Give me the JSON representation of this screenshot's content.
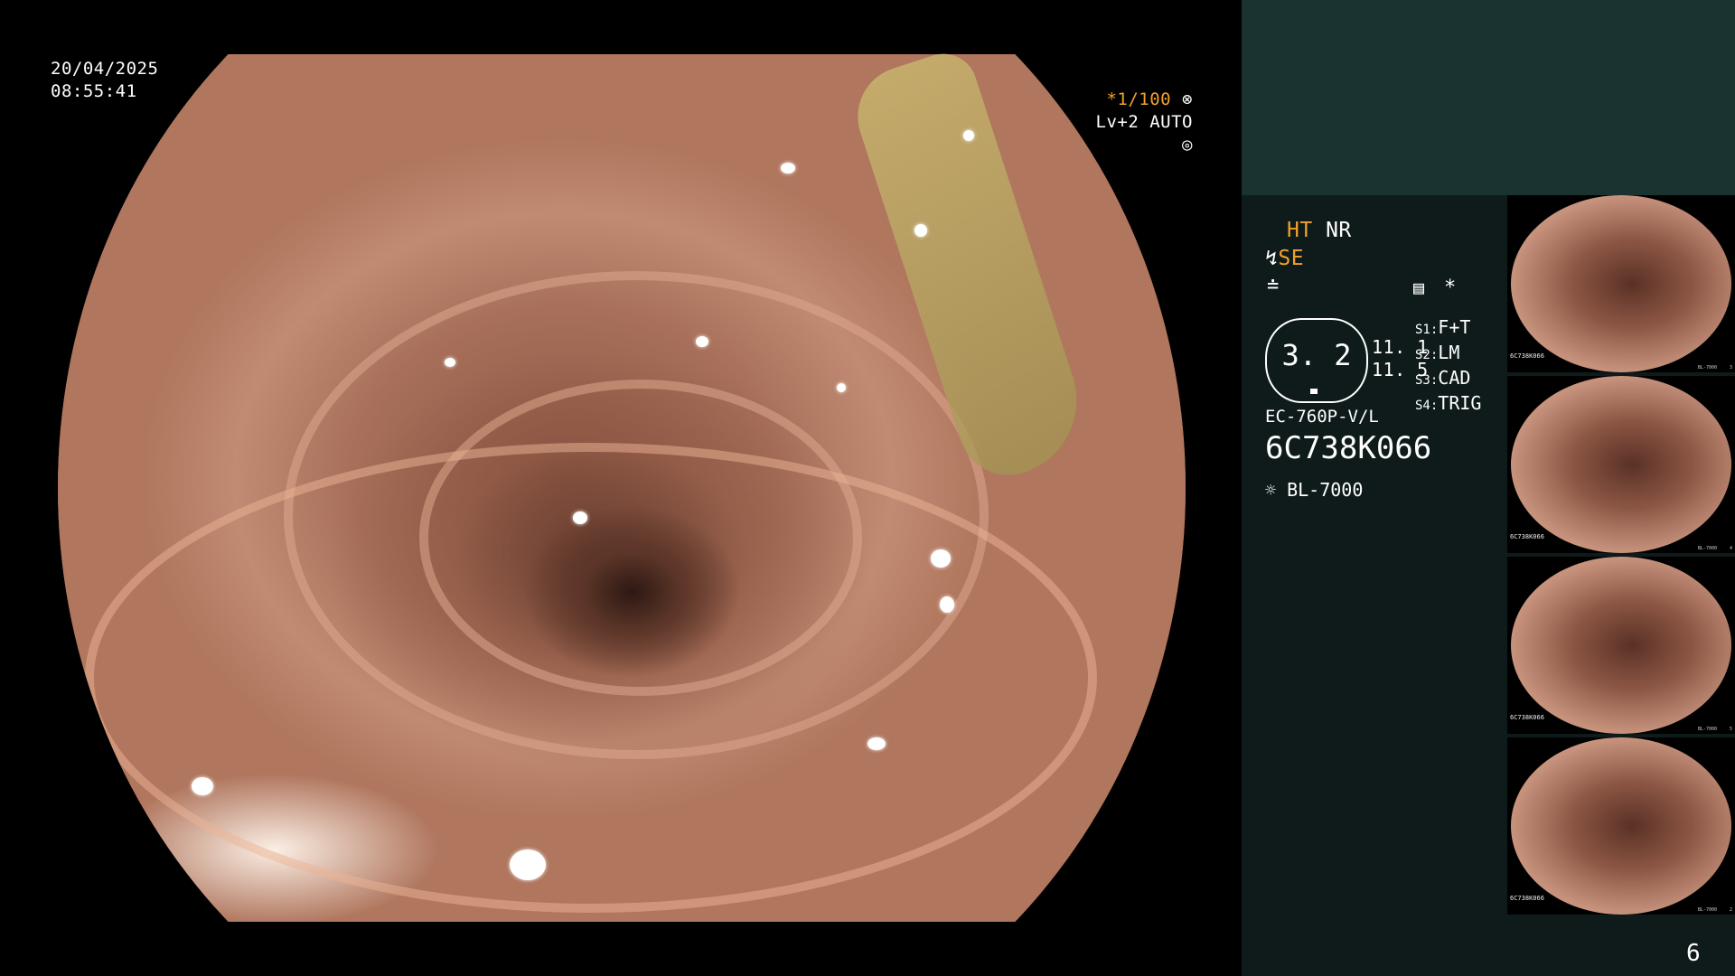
{
  "datetime": {
    "date": "20/04/2025",
    "time": "08:55:41"
  },
  "exposure": {
    "shutter": "*1/100",
    "level": "Lv+2",
    "mode": "AUTO",
    "shutter_icon": "aperture-icon",
    "mode_icon": "iris-icon"
  },
  "image_settings": {
    "ht": "HT",
    "nr": "NR",
    "se": "SE",
    "se_icon": "enhancement-icon",
    "filter_icon": "filter-icon",
    "menu_icon": "menu-icon",
    "asterisk": "*"
  },
  "scope": {
    "magnification": "3. 2",
    "value_1": "11. 1",
    "value_2": "11. 5",
    "model": "EC-760P-V/L",
    "serial": "6C738K066"
  },
  "switches": [
    {
      "label": "S1",
      "value": "F+T"
    },
    {
      "label": "S2",
      "value": "LM"
    },
    {
      "label": "S3",
      "value": "CAD"
    },
    {
      "label": "S4",
      "value": "TRIG"
    }
  ],
  "light_source": {
    "icon": "light-source-icon",
    "model": "BL-7000"
  },
  "thumbnails": [
    {
      "id": "6C738K066",
      "source": "BL-7000",
      "index": "3"
    },
    {
      "id": "6C738K066",
      "source": "BL-7000",
      "index": "4"
    },
    {
      "id": "6C738K066",
      "source": "BL-7000",
      "index": "5"
    },
    {
      "id": "6C738K066",
      "source": "BL-7000",
      "index": "2"
    }
  ],
  "page_number": "6",
  "colors": {
    "accent": "#f0a22a",
    "panel_top": "#1b3330",
    "panel_bottom": "#0f1b1a"
  }
}
